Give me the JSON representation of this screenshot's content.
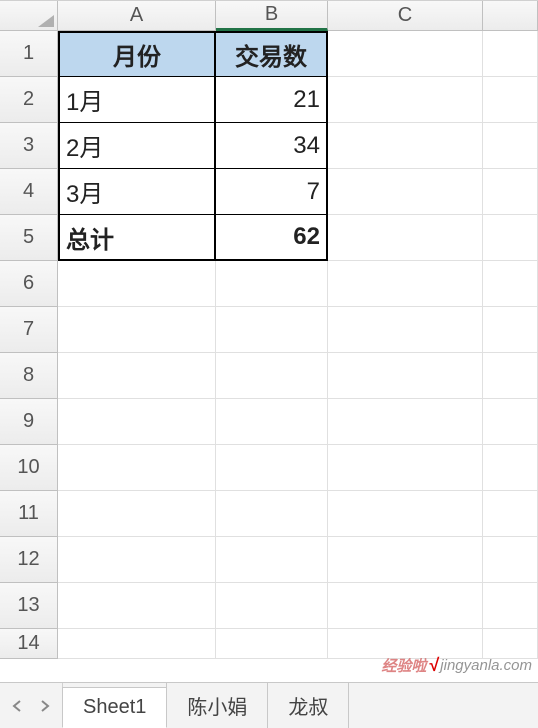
{
  "columns": [
    "A",
    "B",
    "C"
  ],
  "rows": [
    "1",
    "2",
    "3",
    "4",
    "5",
    "6",
    "7",
    "8",
    "9",
    "10",
    "11",
    "12",
    "13",
    "14"
  ],
  "cells": {
    "A1": "月份",
    "B1": "交易数",
    "A2": "1月",
    "B2": "21",
    "A3": "2月",
    "B3": "34",
    "A4": "3月",
    "B4": "7",
    "A5": "总计",
    "B5": "62"
  },
  "sheets": {
    "nav_prev": "‹",
    "nav_next": "›",
    "tabs": [
      {
        "label": "Sheet1",
        "active": true
      },
      {
        "label": "陈小娟",
        "active": false
      },
      {
        "label": "龙叔",
        "active": false
      }
    ]
  },
  "watermark": {
    "part1": "经验啦",
    "check": "√",
    "part2": "jingyanla.com"
  },
  "chart_data": {
    "type": "table",
    "title": "交易数",
    "categories": [
      "1月",
      "2月",
      "3月"
    ],
    "values": [
      21,
      34,
      7
    ],
    "total_label": "总计",
    "total_value": 62,
    "headers": [
      "月份",
      "交易数"
    ]
  }
}
